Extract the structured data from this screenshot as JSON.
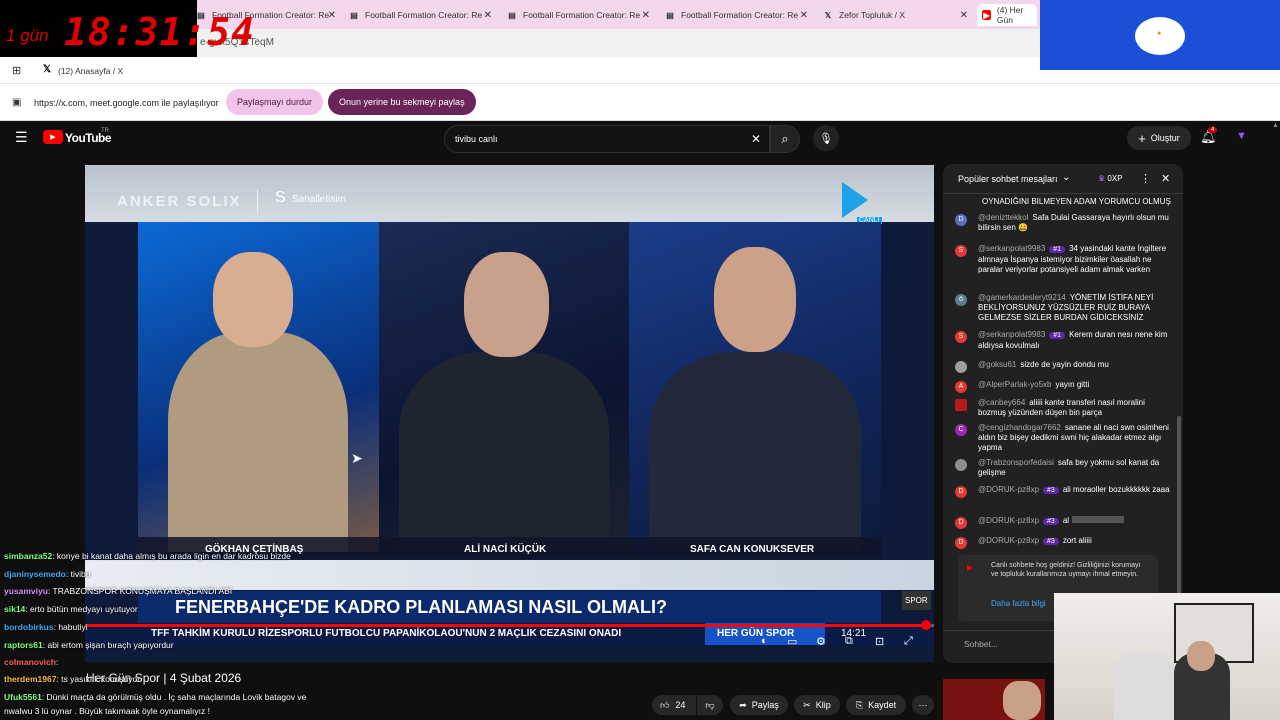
{
  "tabs": [
    {
      "label": "Football Formation Creator: Re"
    },
    {
      "label": "Football Formation Creator: Re"
    },
    {
      "label": "Football Formation Creator: Re"
    },
    {
      "label": "Football Formation Creator: Re"
    },
    {
      "label": "Zefor Topluluk / X"
    },
    {
      "label": "(4) Her Gün"
    }
  ],
  "address": {
    "url": "e-gux5Q14TeqM"
  },
  "bookmark": {
    "label": "(12) Anasayfa / X"
  },
  "share": {
    "info": "https://x.com, meet.google.com ile paylaşılıyor",
    "stop_label": "Paylaşmayı durdur",
    "share_instead_label": "Onun yerine bu sekmeyi paylaş"
  },
  "timer": {
    "days": "1 gün",
    "time": "18:31:54"
  },
  "youtube": {
    "logo": "YouTube",
    "region": "TR",
    "search_value": "tivibu canlı",
    "create_label": "Oluştur",
    "notif_count": "4"
  },
  "video": {
    "sponsor": "ANKER SOLIX",
    "sponsor2": "Sanalletisim",
    "channel_logo": "CANLI",
    "names": [
      "GÖKHAN ÇETİNBAŞ",
      "ALİ NACİ KÜÇÜK",
      "SAFA CAN KONUKSEVER"
    ],
    "headline": "FENERBAHÇE'DE KADRO PLANLAMASI NASIL OLMALI?",
    "ticker": "TFF TAHKİM KURULU RİZESPORLU FUTBOLCU PAPANİKOLAOU'NUN 2 MAÇLIK CEZASINI ONADI",
    "show": "HER GÜN SPOR",
    "clock": "14:21"
  },
  "below": {
    "title": "Her Gün Spor | 4 Şubat 2026",
    "likes": "24",
    "share": "Paylaş",
    "clip": "Klip",
    "save": "Kaydet"
  },
  "chat": {
    "header": "Popüler sohbet mesajları",
    "points": "0XP",
    "pinned": "OYNADIĞINI BILMEYEN ADAM YORUMCU OLMUŞ",
    "messages": [
      {
        "user": "@denizttekkol",
        "text": "Safa Dulai Gassaraya hayırlı olsun mu bilirsin sen 😀",
        "color": "#5c6bc0",
        "initial": "D",
        "badge": ""
      },
      {
        "user": "@serkanpolat9983",
        "text": "34 yasindaki kante İngiltere almnaya İspanya istemiyor bizimkiler öasallah ne paralar veriyorlar potansiyeli adam almak varken",
        "color": "#e53935",
        "initial": "S",
        "badge": "#1"
      },
      {
        "user": "@gamerkardesleryt9214",
        "text": "YÖNETİM İSTİFA NEYİ BEKLİYORSUNUZ YÜZSÜZLER RUİZ BURAYA GELMEZSE SİZLER BURDAN GİDİCEKSİNİZ",
        "color": "#607d8b",
        "initial": "ö",
        "badge": ""
      },
      {
        "user": "@serkanpolat9983",
        "text": "Kerem duran nesı nene kim aldıysa kovulmalı",
        "color": "#e53935",
        "initial": "S",
        "badge": "#1"
      },
      {
        "user": "@goksu61",
        "text": "sizde de yayin dondu mu",
        "color": "#9e9e9e",
        "initial": "",
        "badge": ""
      },
      {
        "user": "@AlperParlak-yo5xb",
        "text": "yayın gitti",
        "color": "#e53935",
        "initial": "A",
        "badge": ""
      },
      {
        "user": "@canbey664",
        "text": "aliiii kante transferi nasıl moralini bozmuş yüzünden düşen bin parça",
        "color": "#b71c1c",
        "initial": "",
        "badge": ""
      },
      {
        "user": "@cengizhandogar7662",
        "text": "sanane ali naci swn osimheni aldın biz bişey dedikmi swni hiç alakadar etmez algı yapma",
        "color": "#9c27b0",
        "initial": "C",
        "badge": ""
      },
      {
        "user": "@Trabzonsporfedaisi",
        "text": "safa bey yokmu sol kanat da gelişme",
        "color": "#8d8d8d",
        "initial": "",
        "badge": ""
      },
      {
        "user": "@DORUK-pz8xp",
        "text": "ali moraoller bozukkkkkk zaaa",
        "color": "#e53935",
        "initial": "D",
        "badge": "#3"
      },
      {
        "user": "@DORUK-pz8xp",
        "text": "al",
        "color": "#e53935",
        "initial": "D",
        "badge": "#3"
      },
      {
        "user": "@DORUK-pz8xp",
        "text": "zort aliiii",
        "color": "#e53935",
        "initial": "D",
        "badge": "#3"
      }
    ],
    "welcome": "Canlı sohbete hoş geldiniz! Gizliliğinizi korumayı ve topluluk kurallarımıza uymayı ihmal etmeyin.",
    "welcome_link": "Daha fazla bilgi",
    "input_placeholder": "Sohbet..."
  },
  "stream_chat": [
    {
      "user": "simbanza52",
      "text": ": konye bi kanat daha almış bu arada ligin en dar kadrosu bizde",
      "color": "#7fff7f"
    },
    {
      "user": "djaninysemedo",
      "text": ": tivibu",
      "color": "#3fa9f5"
    },
    {
      "user": "yusamviyu",
      "text": ": TRABZONSPOR KONUŞMAYA BAŞLANDI ABİ",
      "color": "#d18cff"
    },
    {
      "user": "sik14",
      "text": ": erto bütün medyayı uyutuyor",
      "color": "#7fff7f"
    },
    {
      "user": "bordobirkus",
      "text": ": habutiyi",
      "color": "#3fa9f5"
    },
    {
      "user": "raptors61",
      "text": ": abi ertom şişan bıraçh yapıyordur",
      "color": "#7fff7f"
    },
    {
      "user": "colmanovich",
      "text": ":",
      "color": "#ff5e5e"
    },
    {
      "user": "therdem1967",
      "text": ": ts yasıklık konuşuyor",
      "color": "#ffb84d"
    },
    {
      "user": "Ufuk5561",
      "text": ": Dünki maçta da görülmüş oldu . İç saha maçlarında Lovik batagov ve",
      "color": "#7fff7f"
    },
    {
      "user": "",
      "text": "nwalwu 3 lü oynar . Büyük takımaak öyle oynamalıyız !",
      "color": "#ffffff"
    }
  ],
  "colors": {
    "accent": "#ff0000",
    "tabbar": "#f3d7ec",
    "chat_bg": "#212121"
  }
}
